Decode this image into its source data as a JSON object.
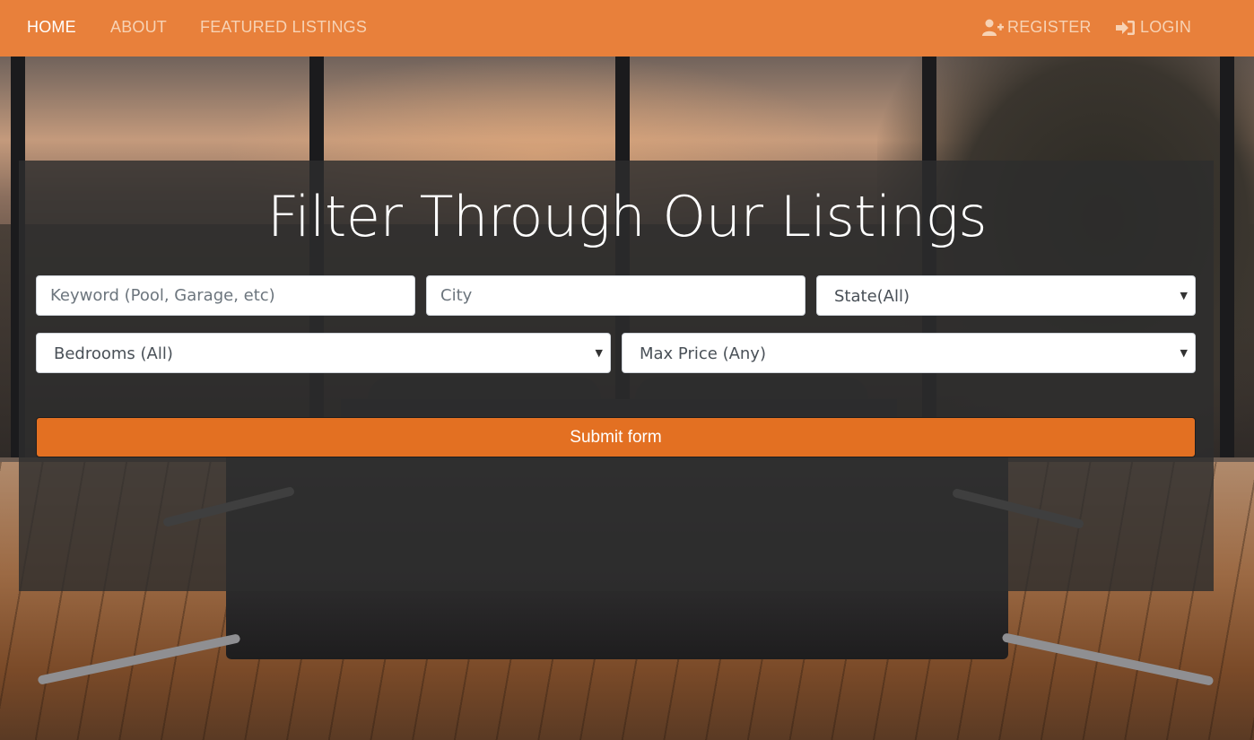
{
  "nav": {
    "home": "HOME",
    "about": "ABOUT",
    "featured": "FEATURED LISTINGS",
    "register": "REGISTER",
    "login": "LOGIN",
    "register_icon": "user-plus-icon",
    "login_icon": "sign-in-icon"
  },
  "search": {
    "title": "Filter Through Our Listings",
    "keyword_placeholder": "Keyword (Pool, Garage, etc)",
    "city_placeholder": "City",
    "state_selected": "State(All)",
    "bedrooms_selected": "Bedrooms (All)",
    "max_price_selected": "Max Price (Any)",
    "submit_label": "Submit form"
  },
  "colors": {
    "nav_bg": "#e8803b",
    "submit_bg": "#e37022",
    "panel_bg": "rgba(45,45,45,0.82)"
  }
}
